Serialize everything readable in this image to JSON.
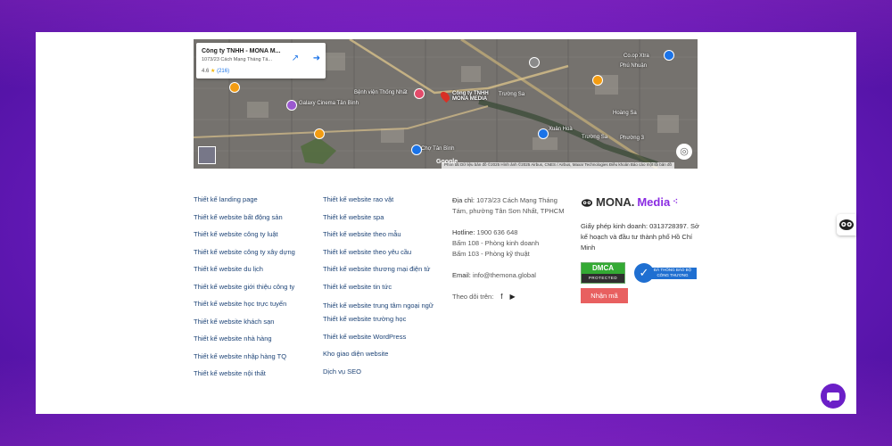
{
  "map": {
    "place_title": "Công ty TNHH - MONA M...",
    "place_address": "1073/23 Cách Mạng Tháng Tá...",
    "rating": "4.6",
    "review_count": "(216)",
    "labels": [
      "Công ty TNHH\nMONA MEDIA",
      "Bệnh viện Thống Nhất",
      "Galaxy Cinema Tân Bình",
      "Trường Sa",
      "Chợ Tân Bình",
      "Co.op Xtra",
      "Phú Nhuận",
      "Xuân Hoà",
      "Trường Sa",
      "Hoàng Sa",
      "Phường 3"
    ],
    "google": "Google",
    "attribution": "Phím tắt   Dữ liệu bản đồ ©2025 Hình ảnh ©2025 Airbus, CNES / Airbus, Maxar Technologies   Điều khoản   Báo cáo một lỗi bản đồ"
  },
  "col1": [
    "Thiết kế landing page",
    "Thiết kế website bất động sản",
    "Thiết kế website công ty luật",
    "Thiết kế website công ty xây dựng",
    "Thiết kế website du lịch",
    "Thiết kế website giới thiệu công ty",
    "Thiết kế website học trực tuyến",
    "Thiết kế website khách sạn",
    "Thiết kế website nhà hàng",
    "Thiết kế website nhập hàng TQ",
    "Thiết kế website nội thất"
  ],
  "col2": [
    "Thiết kế website rao vặt",
    "Thiết kế website spa",
    "Thiết kế website theo mẫu",
    "Thiết kế website theo yêu cầu",
    "Thiết kế website thương mại điện tử",
    "Thiết kế website tin tức",
    "Thiết kế website trung tâm ngoại ngữ",
    "Thiết kế website trường học",
    "Thiết kế website WordPress",
    "Kho giao diện website",
    "Dịch vụ SEO"
  ],
  "contact": {
    "address_label": "Địa chỉ:",
    "address": "1073/23 Cách Mạng Tháng Tám, phường Tân Sơn Nhất, TPHCM",
    "hotline_label": "Hotline:",
    "hotline": "1900 636 648",
    "press108": "Bấm 108 - Phòng kinh doanh",
    "press103": "Bấm 103 - Phòng kỹ thuật",
    "email_label": "Email:",
    "email": "info@themona.global",
    "follow_label": "Theo dõi trên:"
  },
  "brand": {
    "logo_a": "MONA.",
    "logo_b": "Media",
    "license": "Giấy phép kinh doanh: 0313728397. Sở kế hoạch và đầu tư thành phố Hồ Chí Minh",
    "dmca_top": "DMCA",
    "dmca_bottom": "PROTECTED",
    "bct_text": "ĐÃ THÔNG BÁO BỘ CÔNG THƯƠNG",
    "code_button": "Nhận mã"
  }
}
